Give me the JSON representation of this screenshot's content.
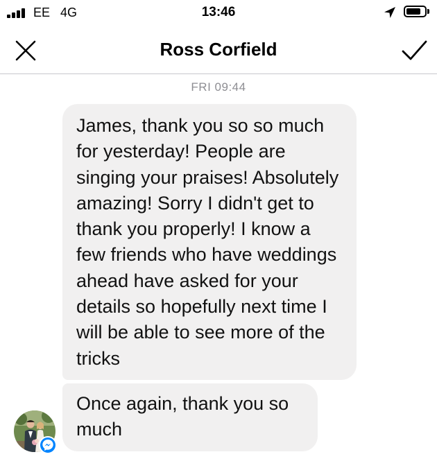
{
  "status_bar": {
    "carrier": "EE",
    "network": "4G",
    "time": "13:46",
    "signal_bars": 4,
    "battery_level": 0.8,
    "icons": [
      "signal-icon",
      "location-arrow-icon",
      "battery-icon"
    ]
  },
  "header": {
    "title": "Ross Corfield",
    "close_icon": "close-icon",
    "confirm_icon": "checkmark-icon"
  },
  "conversation": {
    "timestamp": "FRI 09:44",
    "messages": [
      {
        "text": "James, thank you so so much for yesterday! People are singing your praises! Absolutely amazing! Sorry I didn't get to thank you properly! I know a few friends who have weddings ahead have asked for your details so hopefully next time I will be able to see more of the tricks"
      },
      {
        "text": "Once again, thank you so much"
      }
    ]
  },
  "colors": {
    "bubble": "#f1f0f0",
    "timestamp": "#8e8e93",
    "messenger_badge": "#0084ff",
    "divider": "#c8c7cc"
  }
}
